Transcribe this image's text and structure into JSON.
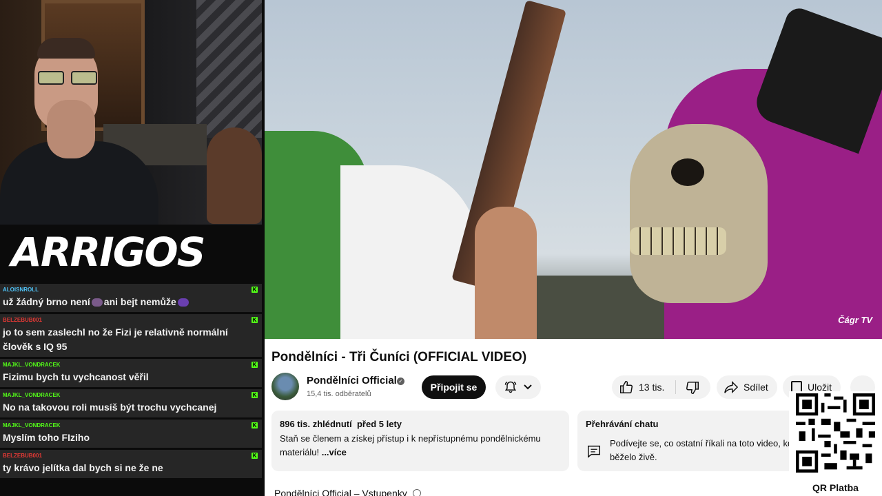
{
  "stream": {
    "logo_text": "ARRIGOS",
    "chat": [
      {
        "user": "ALOISNROLL",
        "user_color": "#4fc3f7",
        "text_before": "už žádný brno není",
        "text_mid": "ani bejt nemůže",
        "text_after": ""
      },
      {
        "user": "BELZEBUB001",
        "user_color": "#e53935",
        "text_before": "jo to sem zaslechl no že Fizi je relativně normální člověk s IQ 95",
        "text_mid": "",
        "text_after": ""
      },
      {
        "user": "MAJKL_VONDRACEK",
        "user_color": "#53fc18",
        "text_before": "Fizimu bych tu vychcanost věřil",
        "text_mid": "",
        "text_after": ""
      },
      {
        "user": "MAJKL_VONDRACEK",
        "user_color": "#53fc18",
        "text_before": "No na takovou roli musíš být trochu vychcanej",
        "text_mid": "",
        "text_after": ""
      },
      {
        "user": "MAJKL_VONDRACEK",
        "user_color": "#53fc18",
        "text_before": "Myslím toho FIziho",
        "text_mid": "",
        "text_after": ""
      },
      {
        "user": "BELZEBUB001",
        "user_color": "#e53935",
        "text_before": "ty krávo jelítka dal bych si ne že ne",
        "text_mid": "",
        "text_after": ""
      }
    ],
    "badge_glyph": "K"
  },
  "video": {
    "watermark": "Čágr TV",
    "title": "Pondělníci - Tři Čuníci (OFFICIAL VIDEO)",
    "channel_name": "Pondělníci Official",
    "subscribers": "15,4 tis. odběratelů",
    "join_label": "Připojit se",
    "likes": "13 tis.",
    "share_label": "Sdílet",
    "save_label": "Uložit",
    "views": "896 tis. zhlédnutí",
    "age": "před 5 lety",
    "description": "Staň se členem a získej přístup i k nepřístupnému pondělnickému materiálu!",
    "more_label": "...více",
    "chat_replay_title": "Přehrávání chatu",
    "chat_replay_text": "Podívejte se, co ostatní říkali na toto video, když běželo živě.",
    "link_row": "Pondělníci Official – Vstupenky"
  },
  "qr": {
    "label": "QR Platba"
  }
}
